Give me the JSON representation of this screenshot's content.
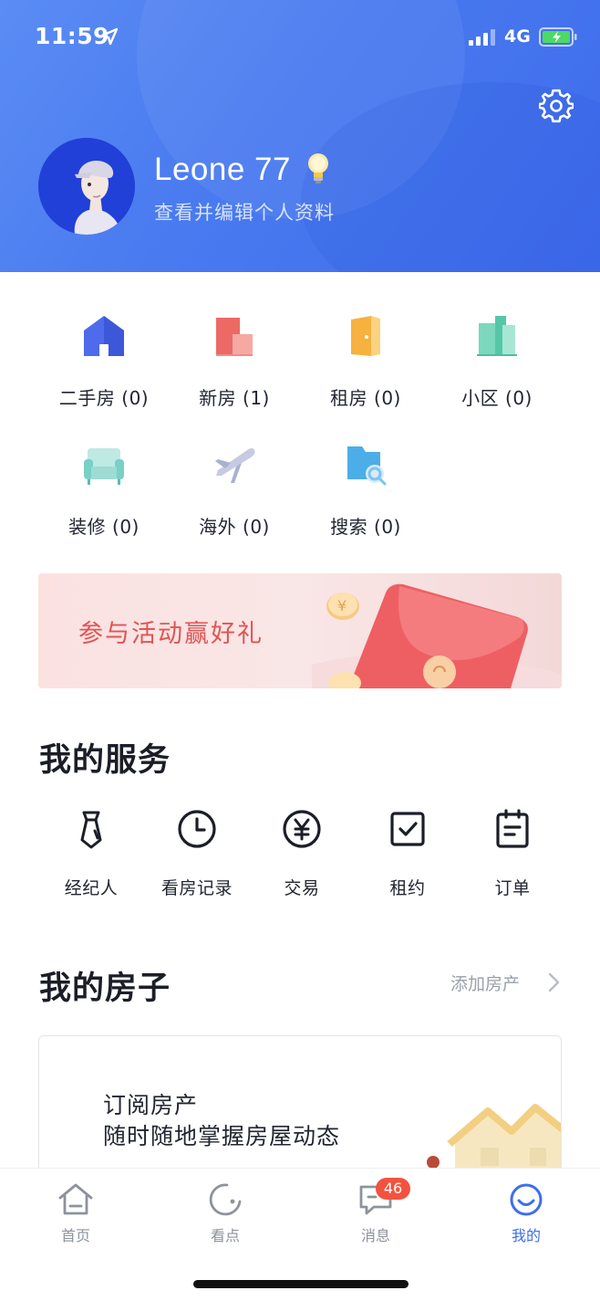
{
  "status_bar": {
    "time": "11:59",
    "network": "4G"
  },
  "profile": {
    "name": "Leone 77",
    "edit_link": "查看并编辑个人资料"
  },
  "categories": [
    {
      "label": "二手房 (0)",
      "icon": "house-icon"
    },
    {
      "label": "新房 (1)",
      "icon": "building-icon"
    },
    {
      "label": "租房 (0)",
      "icon": "door-icon"
    },
    {
      "label": "小区 (0)",
      "icon": "community-icon"
    },
    {
      "label": "装修 (0)",
      "icon": "sofa-icon"
    },
    {
      "label": "海外 (0)",
      "icon": "airplane-icon"
    },
    {
      "label": "搜索 (0)",
      "icon": "folder-search-icon"
    }
  ],
  "banner": {
    "text": "参与活动赢好礼"
  },
  "services": {
    "title": "我的服务",
    "items": [
      {
        "label": "经纪人",
        "icon": "tie-icon"
      },
      {
        "label": "看房记录",
        "icon": "clock-icon"
      },
      {
        "label": "交易",
        "icon": "yuan-icon"
      },
      {
        "label": "租约",
        "icon": "checkbox-icon"
      },
      {
        "label": "订单",
        "icon": "clipboard-icon"
      }
    ]
  },
  "my_house": {
    "title": "我的房子",
    "add_label": "添加房产",
    "card_title": "订阅房产",
    "card_subtitle": "随时随地掌握房屋动态"
  },
  "tabbar": {
    "items": [
      {
        "label": "首页",
        "icon": "home-icon"
      },
      {
        "label": "看点",
        "icon": "discover-icon"
      },
      {
        "label": "消息",
        "icon": "message-icon"
      },
      {
        "label": "我的",
        "icon": "profile-icon"
      }
    ],
    "active": "我的",
    "message_badge": "46"
  },
  "colors": {
    "accent": "#3d6df0",
    "header": "#4a7bf0",
    "badge": "#f2533f",
    "banner_text": "#e15454"
  }
}
